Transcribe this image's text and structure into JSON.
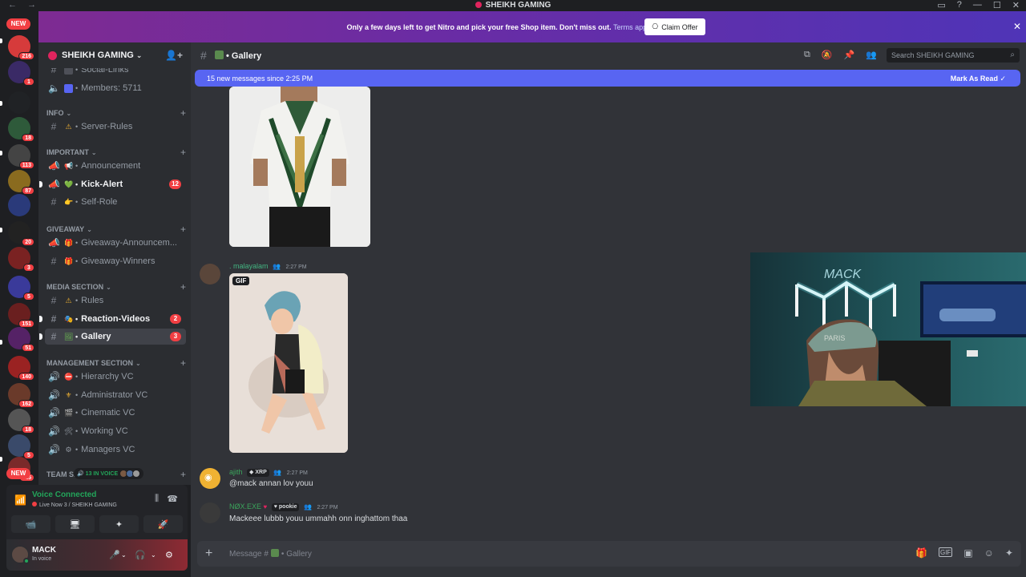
{
  "window": {
    "title": "SHEIKH GAMING",
    "nav_back": "←",
    "nav_fwd": "→",
    "controls": [
      "▭",
      "?",
      "—",
      "☐",
      "✕"
    ]
  },
  "rail": {
    "new_top": "NEW",
    "new_bottom": "NEW",
    "servers": [
      {
        "badge": "216",
        "color": "#d63b3b"
      },
      {
        "badge": "1",
        "color": "#3a2a66"
      },
      {
        "badge": "",
        "color": "#202225"
      },
      {
        "badge": "18",
        "color": "#2e5a3a"
      },
      {
        "badge": "113",
        "color": "#444"
      },
      {
        "badge": "87",
        "color": "#8a6b1f"
      },
      {
        "badge": "",
        "color": "#2a3a7a"
      },
      {
        "badge": "20",
        "color": "#222"
      },
      {
        "badge": "3",
        "color": "#7a2222"
      },
      {
        "badge": "5",
        "color": "#3a3a9a"
      },
      {
        "badge": "151",
        "color": "#6a1f1f"
      },
      {
        "badge": "51",
        "color": "#552266"
      },
      {
        "badge": "140",
        "color": "#9a2222"
      },
      {
        "badge": "162",
        "color": "#6a3a2a"
      },
      {
        "badge": "18",
        "color": "#555"
      },
      {
        "badge": "5",
        "color": "#3a4a6a"
      },
      {
        "badge": "115",
        "color": "#7a2a2a"
      }
    ]
  },
  "banner": {
    "text": "Only a few days left to get Nitro and pick your free Shop item. Don't miss out.",
    "link": "Terms apply.",
    "button": "Claim Offer",
    "close": "✕"
  },
  "server": {
    "name": "SHEIKH GAMING",
    "chevron": "⌄",
    "invite": "👤+"
  },
  "sidebar": {
    "channels_top": [
      {
        "icon": "#",
        "emoji": "",
        "name": "Social-Links"
      },
      {
        "icon": "🔈",
        "emoji": "",
        "name": "Members: 5711"
      }
    ],
    "categories": [
      {
        "name": "INFO",
        "channels": [
          {
            "icon": "#",
            "emoji": "⚠",
            "name": "Server-Rules",
            "badge": "",
            "unread": false,
            "active": false
          }
        ]
      },
      {
        "name": "IMPORTANT",
        "channels": [
          {
            "icon": "📢",
            "emoji": "📢",
            "name": "Announcement",
            "badge": "",
            "unread": false,
            "active": false
          },
          {
            "icon": "📢",
            "emoji": "💚",
            "name": "Kick-Alert",
            "badge": "12",
            "unread": true,
            "active": false
          },
          {
            "icon": "#",
            "emoji": "👉",
            "name": "Self-Role",
            "badge": "",
            "unread": false,
            "active": false
          }
        ]
      },
      {
        "name": "GIVEAWAY",
        "channels": [
          {
            "icon": "📢",
            "emoji": "🎁",
            "name": "Giveaway-Announcem...",
            "badge": "",
            "unread": false,
            "active": false
          },
          {
            "icon": "#",
            "emoji": "🎁",
            "name": "Giveaway-Winners",
            "badge": "",
            "unread": false,
            "active": false
          }
        ]
      },
      {
        "name": "MEDIA SECTION",
        "channels": [
          {
            "icon": "#",
            "emoji": "⚠",
            "name": "Rules",
            "badge": "",
            "unread": false,
            "active": false
          },
          {
            "icon": "#",
            "emoji": "🎭",
            "name": "Reaction-Videos",
            "badge": "2",
            "unread": true,
            "active": false
          },
          {
            "icon": "#",
            "emoji": "🖼",
            "name": "Gallery",
            "badge": "3",
            "unread": true,
            "active": true
          }
        ]
      },
      {
        "name": "MANAGEMENT SECTION",
        "channels": [
          {
            "icon": "🔈",
            "emoji": "⛔",
            "name": "Hierarchy VC",
            "badge": "",
            "unread": false,
            "active": false
          },
          {
            "icon": "🔈",
            "emoji": "⚜",
            "name": "Administrator VC",
            "badge": "",
            "unread": false,
            "active": false
          },
          {
            "icon": "🔈",
            "emoji": "🎬",
            "name": "Cinematic VC",
            "badge": "",
            "unread": false,
            "active": false
          },
          {
            "icon": "🔈",
            "emoji": "🛠",
            "name": "Working VC",
            "badge": "",
            "unread": false,
            "active": false
          },
          {
            "icon": "🔈",
            "emoji": "⚙",
            "name": "Managers VC",
            "badge": "",
            "unread": false,
            "active": false
          }
        ]
      }
    ],
    "team_category": "TEAM SE",
    "voice_pill": "13 IN VOICE"
  },
  "voice": {
    "title": "Voice Connected",
    "subtitle": "Live Now 3 / SHEIKH GAMING",
    "actions": [
      "📹",
      "🖥",
      "✦",
      "🚀"
    ]
  },
  "user": {
    "name": "MACK",
    "status": "In voice",
    "controls": [
      "🎤",
      "⌄",
      "🎧",
      "⌄",
      "⚙"
    ]
  },
  "channel": {
    "hash": "#",
    "name": "Gallery",
    "tools": [
      "⧉",
      "🔕",
      "📌",
      "👥"
    ],
    "search_placeholder": "Search SHEIKH GAMING",
    "search_icon": "⌕"
  },
  "new_messages": {
    "text": "15 new messages since 2:25 PM",
    "mark": "Mark As Read"
  },
  "messages": [
    {
      "author": ". malayalam",
      "time": "2:27 PM",
      "gif_label": "GIF",
      "text": ""
    },
    {
      "author": "ajith",
      "tag": "XRP",
      "time": "2:27 PM",
      "text": "@mack annan lov youu"
    },
    {
      "author": "NØX.EXE",
      "tag": "pookie",
      "time": "2:27 PM",
      "text": "Mackeee lubbb youu ummahh onn inghattom thaa"
    }
  ],
  "composer": {
    "plus": "+",
    "placeholder_prefix": "Message #",
    "placeholder_channel": "Gallery",
    "tools": [
      "🎁",
      "GIF",
      "▣",
      "☺",
      "✦"
    ]
  },
  "stream": {
    "neon_text": "MACK",
    "cap_text": "PARIS"
  }
}
